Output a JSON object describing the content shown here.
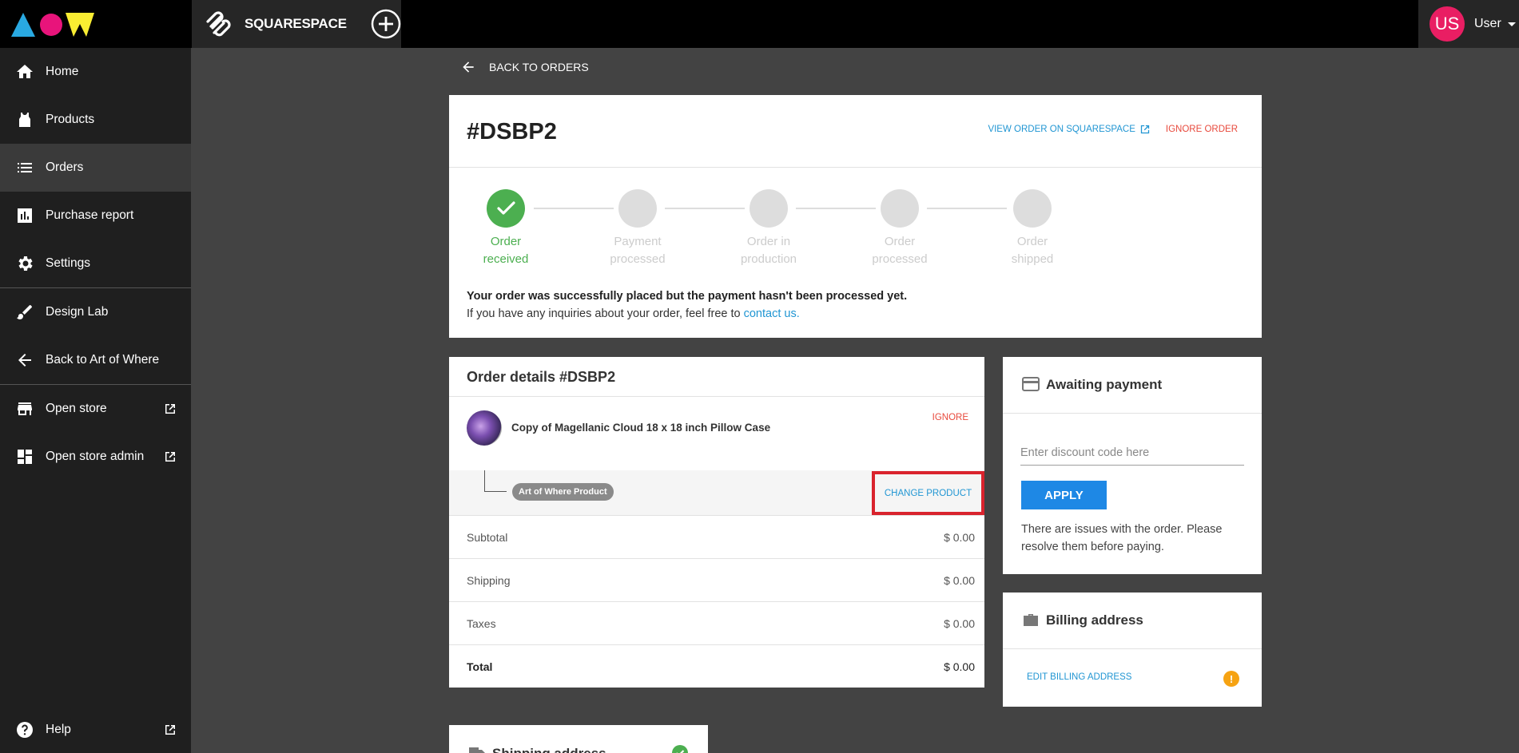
{
  "topbar": {
    "brand": "SQUARESPACE",
    "user": {
      "initials": "US",
      "name": "User"
    }
  },
  "sidebar": {
    "items": [
      {
        "label": "Home"
      },
      {
        "label": "Products"
      },
      {
        "label": "Orders"
      },
      {
        "label": "Purchase report"
      },
      {
        "label": "Settings"
      },
      {
        "label": "Design Lab"
      },
      {
        "label": "Back to Art of Where"
      },
      {
        "label": "Open store"
      },
      {
        "label": "Open store admin"
      },
      {
        "label": "Help"
      }
    ],
    "active": "Orders"
  },
  "back_link": "BACK TO ORDERS",
  "order": {
    "title": "#DSBP2",
    "view_link": "VIEW ORDER ON SQUARESPACE",
    "ignore_link": "IGNORE ORDER",
    "steps": [
      {
        "line1": "Order",
        "line2": "received",
        "done": true
      },
      {
        "line1": "Payment",
        "line2": "processed",
        "done": false
      },
      {
        "line1": "Order in",
        "line2": "production",
        "done": false
      },
      {
        "line1": "Order",
        "line2": "processed",
        "done": false
      },
      {
        "line1": "Order",
        "line2": "shipped",
        "done": false
      }
    ],
    "message_bold": "Your order was successfully placed but the payment hasn't been processed yet.",
    "message_text": "If you have any inquiries about your order, feel free to",
    "message_link": "contact us."
  },
  "order_details": {
    "title": "Order details #DSBP2",
    "product_name": "Copy of Magellanic Cloud 18 x 18 inch Pillow Case",
    "ignore": "IGNORE",
    "tag": "Art of Where Product",
    "change_product": "CHANGE PRODUCT",
    "summary": [
      {
        "label": "Subtotal",
        "value": "$ 0.00"
      },
      {
        "label": "Shipping",
        "value": "$ 0.00"
      },
      {
        "label": "Taxes",
        "value": "$ 0.00"
      },
      {
        "label": "Total",
        "value": "$ 0.00"
      }
    ]
  },
  "payment": {
    "title": "Awaiting payment",
    "discount_placeholder": "Enter discount code here",
    "apply": "APPLY",
    "issue": "There are issues with the order. Please resolve them before paying."
  },
  "billing": {
    "title": "Billing address",
    "edit": "EDIT BILLING ADDRESS",
    "warning": "!"
  },
  "shipping": {
    "title": "Shipping address"
  },
  "colors": {
    "accent_blue": "#2196d3",
    "danger_red": "#e8493c",
    "success_green": "#4caf50",
    "warning_orange": "#f6a313",
    "highlight_red": "#d9232d"
  }
}
